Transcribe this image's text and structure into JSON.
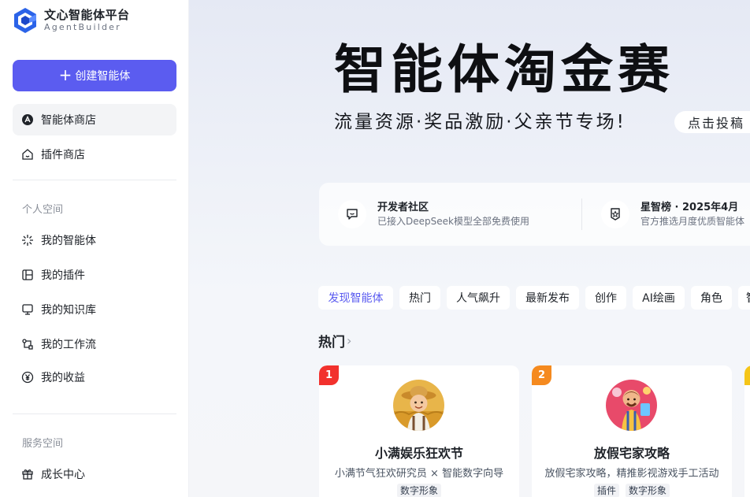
{
  "app": {
    "name": "文心智能体平台",
    "subname": "AgentBuilder",
    "brand_color": "#5b5cf0"
  },
  "sidebar": {
    "create_label": "创建智能体",
    "items": [
      {
        "label": "智能体商店",
        "icon": "store-icon",
        "active": true
      },
      {
        "label": "插件商店",
        "icon": "plugin-store-icon"
      }
    ],
    "personal_title": "个人空间",
    "personal_items": [
      {
        "label": "我的智能体",
        "icon": "sparkle-icon"
      },
      {
        "label": "我的插件",
        "icon": "layout-icon"
      },
      {
        "label": "我的知识库",
        "icon": "monitor-icon"
      },
      {
        "label": "我的工作流",
        "icon": "workflow-icon"
      },
      {
        "label": "我的收益",
        "icon": "yen-icon"
      }
    ],
    "service_title": "服务空间",
    "service_items": [
      {
        "label": "成长中心",
        "icon": "gift-icon"
      }
    ]
  },
  "banner": {
    "title": "智能体淘金赛",
    "subtitle": "流量资源·奖品激励·父亲节专场!",
    "cta": "点击投稿"
  },
  "info": [
    {
      "title": "开发者社区",
      "desc": "已接入DeepSeek模型全部免费使用",
      "icon": "chat-icon"
    },
    {
      "title": "星智榜 · 2025年4月",
      "desc": "官方推选月度优质智能体",
      "icon": "medal-icon"
    }
  ],
  "tabs": [
    "发现智能体",
    "热门",
    "人气飙升",
    "最新发布",
    "创作",
    "AI绘画",
    "角色",
    "智"
  ],
  "section": {
    "title": "热门"
  },
  "cards": [
    {
      "rank": "1",
      "rank_color": "#f2312d",
      "name": "小满娱乐狂欢节",
      "desc": "小满节气狂欢研究员 × 智能数字向导",
      "tags": [
        "数字形象"
      ]
    },
    {
      "rank": "2",
      "rank_color": "#f58a1f",
      "name": "放假宅家攻略",
      "desc": "放假宅家攻略，精推影视游戏手工活动",
      "tags": [
        "插件",
        "数字形象"
      ]
    }
  ]
}
